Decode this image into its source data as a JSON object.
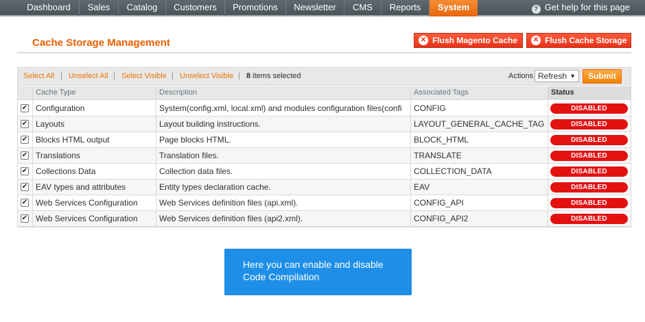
{
  "nav": {
    "items": [
      {
        "label": "Dashboard",
        "active": false
      },
      {
        "label": "Sales",
        "active": false
      },
      {
        "label": "Catalog",
        "active": false
      },
      {
        "label": "Customers",
        "active": false
      },
      {
        "label": "Promotions",
        "active": false
      },
      {
        "label": "Newsletter",
        "active": false
      },
      {
        "label": "CMS",
        "active": false
      },
      {
        "label": "Reports",
        "active": false
      },
      {
        "label": "System",
        "active": true
      }
    ],
    "help_icon": "help-circle-icon",
    "help_label": "Get help for this page"
  },
  "header": {
    "title": "Cache Storage Management",
    "flush_magento_label": "Flush Magento Cache",
    "flush_storage_label": "Flush Cache Storage",
    "button_icon": "close-circle-icon"
  },
  "massaction": {
    "select_all": "Select All",
    "unselect_all": "Unselect All",
    "select_visible": "Select Visible",
    "unselect_visible": "Unselect Visible",
    "separator": "|",
    "selected_count": "8",
    "selected_suffix": " items selected",
    "actions_label": "Actions",
    "actions_value": "Refresh",
    "submit_label": "Submit"
  },
  "table": {
    "columns": [
      "Cache Type",
      "Description",
      "Associated Tags",
      "Status"
    ],
    "rows": [
      {
        "type": "Configuration",
        "description": "System(config.xml, local.xml) and modules configuration files(confi",
        "tags": "CONFIG",
        "status": "DISABLED",
        "checked": true
      },
      {
        "type": "Layouts",
        "description": "Layout building instructions.",
        "tags": "LAYOUT_GENERAL_CACHE_TAG",
        "status": "DISABLED",
        "checked": true
      },
      {
        "type": "Blocks HTML output",
        "description": "Page blocks HTML.",
        "tags": "BLOCK_HTML",
        "status": "DISABLED",
        "checked": true
      },
      {
        "type": "Translations",
        "description": "Translation files.",
        "tags": "TRANSLATE",
        "status": "DISABLED",
        "checked": true
      },
      {
        "type": "Collections Data",
        "description": "Collection data files.",
        "tags": "COLLECTION_DATA",
        "status": "DISABLED",
        "checked": true
      },
      {
        "type": "EAV types and attributes",
        "description": "Entity types declaration cache.",
        "tags": "EAV",
        "status": "DISABLED",
        "checked": true
      },
      {
        "type": "Web Services Configuration",
        "description": "Web Services definition files (api.xml).",
        "tags": "CONFIG_API",
        "status": "DISABLED",
        "checked": true
      },
      {
        "type": "Web Services Configuration",
        "description": "Web Services definition files (api2.xml).",
        "tags": "CONFIG_API2",
        "status": "DISABLED",
        "checked": true
      }
    ]
  },
  "tooltip": {
    "line1": "Here you can enable and disable",
    "line2": "Code Compilation"
  },
  "colors": {
    "accent": "#eb5e00",
    "nav_active": "#f58c33",
    "status_disabled": "#e41111",
    "tooltip_bg": "#1e8fe8"
  }
}
